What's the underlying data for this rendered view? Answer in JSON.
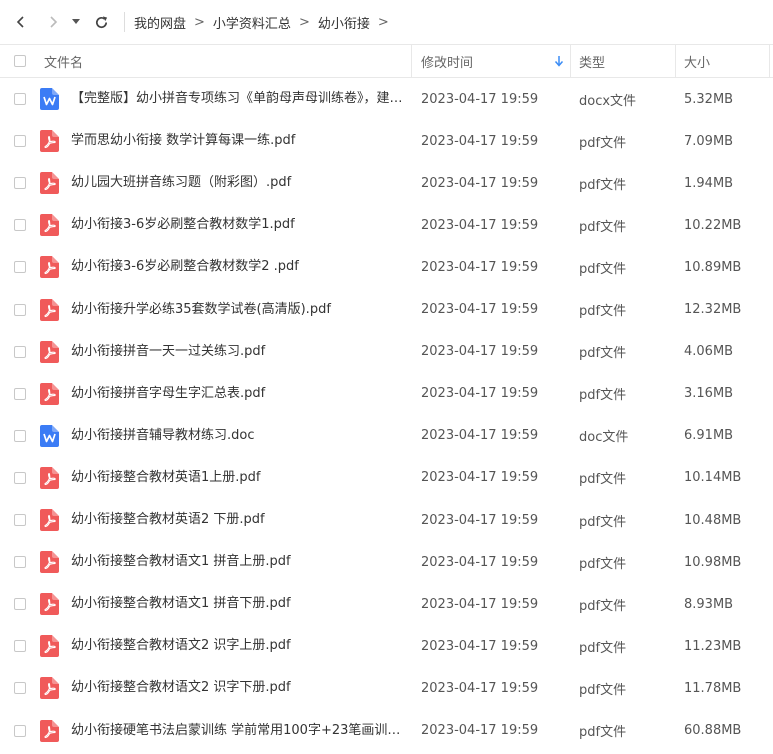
{
  "breadcrumb": [
    "我的网盘",
    "小学资料汇总",
    "幼小衔接"
  ],
  "breadcrumb_separator": ">",
  "columns": {
    "name": "文件名",
    "modified": "修改时间",
    "type": "类型",
    "size": "大小"
  },
  "colors": {
    "pdf": "#f05a5a",
    "doc": "#3b7cf5",
    "sort_arrow": "#3b8cf5"
  },
  "files": [
    {
      "name": "【完整版】幼小拼音专项练习《单韵母声母训练卷》，建…",
      "time": "2023-04-17 19:59",
      "type": "docx文件",
      "size": "5.32MB",
      "icon": "doc"
    },
    {
      "name": "学而思幼小衔接  数学计算每课一练.pdf",
      "time": "2023-04-17 19:59",
      "type": "pdf文件",
      "size": "7.09MB",
      "icon": "pdf"
    },
    {
      "name": "幼儿园大班拼音练习题（附彩图）.pdf",
      "time": "2023-04-17 19:59",
      "type": "pdf文件",
      "size": "1.94MB",
      "icon": "pdf"
    },
    {
      "name": "幼小衔接3-6岁必刷整合教材数学1.pdf",
      "time": "2023-04-17 19:59",
      "type": "pdf文件",
      "size": "10.22MB",
      "icon": "pdf"
    },
    {
      "name": "幼小衔接3-6岁必刷整合教材数学2  .pdf",
      "time": "2023-04-17 19:59",
      "type": "pdf文件",
      "size": "10.89MB",
      "icon": "pdf"
    },
    {
      "name": "幼小衔接升学必练35套数学试卷(高清版).pdf",
      "time": "2023-04-17 19:59",
      "type": "pdf文件",
      "size": "12.32MB",
      "icon": "pdf"
    },
    {
      "name": "幼小衔接拼音一天一过关练习.pdf",
      "time": "2023-04-17 19:59",
      "type": "pdf文件",
      "size": "4.06MB",
      "icon": "pdf"
    },
    {
      "name": "幼小衔接拼音字母生字汇总表.pdf",
      "time": "2023-04-17 19:59",
      "type": "pdf文件",
      "size": "3.16MB",
      "icon": "pdf"
    },
    {
      "name": "幼小衔接拼音辅导教材练习.doc",
      "time": "2023-04-17 19:59",
      "type": "doc文件",
      "size": "6.91MB",
      "icon": "doc"
    },
    {
      "name": "幼小衔接整合教材英语1上册.pdf",
      "time": "2023-04-17 19:59",
      "type": "pdf文件",
      "size": "10.14MB",
      "icon": "pdf"
    },
    {
      "name": "幼小衔接整合教材英语2  下册.pdf",
      "time": "2023-04-17 19:59",
      "type": "pdf文件",
      "size": "10.48MB",
      "icon": "pdf"
    },
    {
      "name": "幼小衔接整合教材语文1  拼音上册.pdf",
      "time": "2023-04-17 19:59",
      "type": "pdf文件",
      "size": "10.98MB",
      "icon": "pdf"
    },
    {
      "name": "幼小衔接整合教材语文1  拼音下册.pdf",
      "time": "2023-04-17 19:59",
      "type": "pdf文件",
      "size": "8.93MB",
      "icon": "pdf"
    },
    {
      "name": "幼小衔接整合教材语文2  识字上册.pdf",
      "time": "2023-04-17 19:59",
      "type": "pdf文件",
      "size": "11.23MB",
      "icon": "pdf"
    },
    {
      "name": "幼小衔接整合教材语文2  识字下册.pdf",
      "time": "2023-04-17 19:59",
      "type": "pdf文件",
      "size": "11.78MB",
      "icon": "pdf"
    },
    {
      "name": "幼小衔接硬笔书法启蒙训练  学前常用100字+23笔画训练…",
      "time": "2023-04-17 19:59",
      "type": "pdf文件",
      "size": "60.88MB",
      "icon": "pdf"
    }
  ]
}
